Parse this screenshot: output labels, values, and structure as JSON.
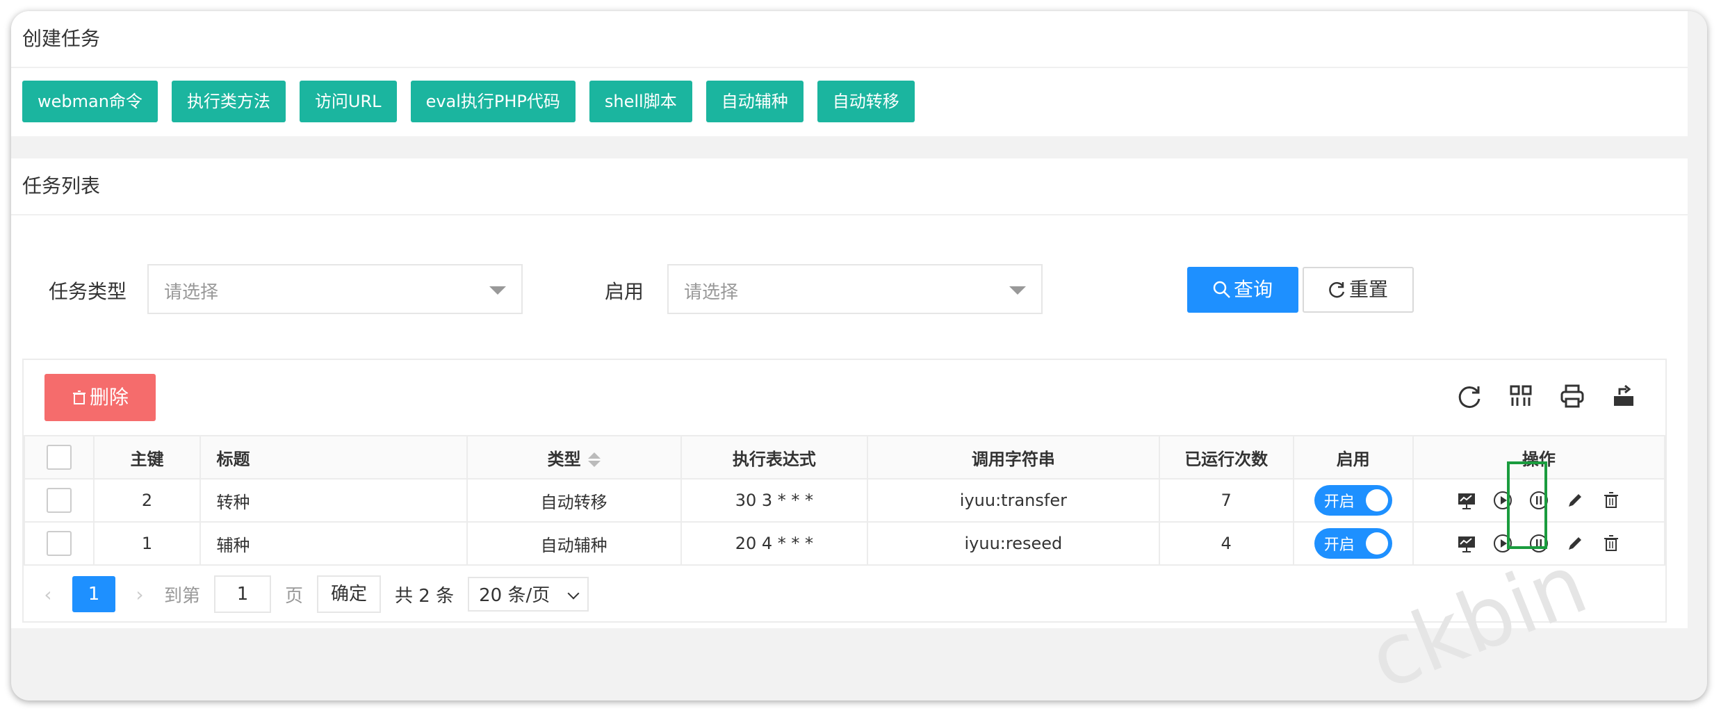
{
  "create": {
    "title": "创建任务",
    "buttons": [
      "webman命令",
      "执行类方法",
      "访问URL",
      "eval执行PHP代码",
      "shell脚本",
      "自动辅种",
      "自动转移"
    ]
  },
  "list": {
    "title": "任务列表",
    "filters": {
      "type_label": "任务类型",
      "type_placeholder": "请选择",
      "enable_label": "启用",
      "enable_placeholder": "请选择"
    },
    "query_label": "查询",
    "reset_label": "重置",
    "delete_label": "删除",
    "table": {
      "headers": [
        "主键",
        "标题",
        "类型",
        "执行表达式",
        "调用字符串",
        "已运行次数",
        "启用",
        "操作"
      ],
      "rows": [
        {
          "id": "2",
          "title": "转种",
          "type": "自动转移",
          "expr": "30 3 * * *",
          "call": "iyuu:transfer",
          "runs": "7",
          "enabled": "开启"
        },
        {
          "id": "1",
          "title": "辅种",
          "type": "自动辅种",
          "expr": "20 4 * * *",
          "call": "iyuu:reseed",
          "runs": "4",
          "enabled": "开启"
        }
      ]
    },
    "pager": {
      "current": "1",
      "goto_label": "到第",
      "goto_value": "1",
      "page_label": "页",
      "confirm": "确定",
      "total": "共 2 条",
      "page_size": "20 条/页"
    }
  },
  "watermark": "ckbin",
  "colors": {
    "green": "#1bb59f",
    "blue": "#1e90ff",
    "red": "#f56c6c",
    "highlight": "#1a9c3e"
  }
}
